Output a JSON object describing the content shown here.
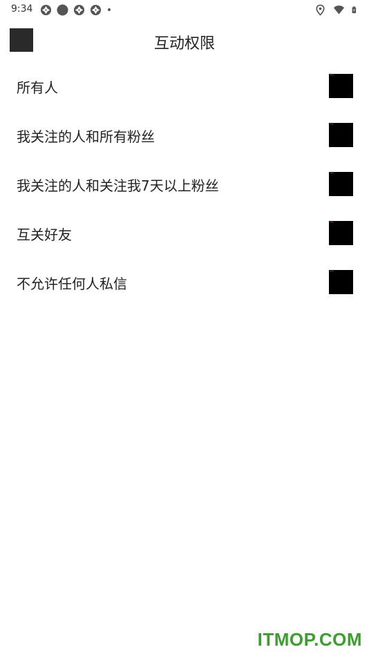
{
  "status_bar": {
    "time": "9:34",
    "left_icons": [
      "aperture-icon",
      "circle-icon",
      "aperture-icon",
      "aperture-icon",
      "dot-icon"
    ],
    "right_icons": [
      "location-icon",
      "wifi-icon",
      "battery-charging-icon"
    ]
  },
  "header": {
    "title": "互动权限",
    "back_icon": "back-button-placeholder"
  },
  "options": [
    {
      "label": "所有人"
    },
    {
      "label": "我关注的人和所有粉丝"
    },
    {
      "label": "我关注的人和关注我7天以上粉丝"
    },
    {
      "label": "互关好友"
    },
    {
      "label": "不允许任何人私信"
    }
  ],
  "watermark": {
    "text": "ITMOP.COM",
    "color": "#3aa02c"
  }
}
